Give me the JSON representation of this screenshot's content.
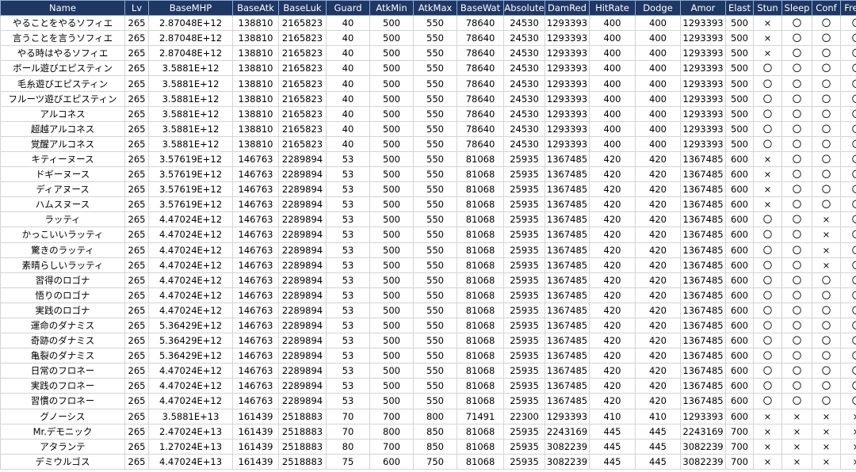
{
  "columns": [
    "Name",
    "Lv",
    "BaseMHP",
    "BaseAtk",
    "BaseLuk",
    "Guard",
    "AtkMin",
    "AtkMax",
    "BaseWat",
    "Absolute",
    "DamRed",
    "HitRate",
    "Dodge",
    "Amor",
    "Elast",
    "Stun",
    "Sleep",
    "Conf",
    "Freez"
  ],
  "rows": [
    [
      "やることをやるソフィエ",
      "265",
      "2.87048E+12",
      "138810",
      "2165823",
      "40",
      "500",
      "550",
      "78640",
      "24530",
      "1293393",
      "400",
      "400",
      "1293393",
      "500",
      "×",
      "〇",
      "〇",
      "〇"
    ],
    [
      "言うことを言うソフィエ",
      "265",
      "2.87048E+12",
      "138810",
      "2165823",
      "40",
      "500",
      "550",
      "78640",
      "24530",
      "1293393",
      "400",
      "400",
      "1293393",
      "500",
      "×",
      "〇",
      "〇",
      "〇"
    ],
    [
      "やる時はやるソフィエ",
      "265",
      "2.87048E+12",
      "138810",
      "2165823",
      "40",
      "500",
      "550",
      "78640",
      "24530",
      "1293393",
      "400",
      "400",
      "1293393",
      "500",
      "×",
      "〇",
      "〇",
      "〇"
    ],
    [
      "ボール遊びエピスティン",
      "265",
      "3.5881E+12",
      "138810",
      "2165823",
      "40",
      "500",
      "550",
      "78640",
      "24530",
      "1293393",
      "400",
      "400",
      "1293393",
      "500",
      "〇",
      "〇",
      "〇",
      "〇"
    ],
    [
      "毛糸遊びエピスティン",
      "265",
      "3.5881E+12",
      "138810",
      "2165823",
      "40",
      "500",
      "550",
      "78640",
      "24530",
      "1293393",
      "400",
      "400",
      "1293393",
      "500",
      "〇",
      "〇",
      "〇",
      "〇"
    ],
    [
      "フルーツ遊びエピスティン",
      "265",
      "3.5881E+12",
      "138810",
      "2165823",
      "40",
      "500",
      "550",
      "78640",
      "24530",
      "1293393",
      "400",
      "400",
      "1293393",
      "500",
      "〇",
      "〇",
      "〇",
      "〇"
    ],
    [
      "アルコネス",
      "265",
      "3.5881E+12",
      "138810",
      "2165823",
      "40",
      "500",
      "550",
      "78640",
      "24530",
      "1293393",
      "400",
      "400",
      "1293393",
      "500",
      "〇",
      "〇",
      "〇",
      "〇"
    ],
    [
      "超越アルコネス",
      "265",
      "3.5881E+12",
      "138810",
      "2165823",
      "40",
      "500",
      "550",
      "78640",
      "24530",
      "1293393",
      "400",
      "400",
      "1293393",
      "500",
      "〇",
      "〇",
      "〇",
      "〇"
    ],
    [
      "覚醒アルコネス",
      "265",
      "3.5881E+12",
      "138810",
      "2165823",
      "40",
      "500",
      "550",
      "78640",
      "24530",
      "1293393",
      "400",
      "400",
      "1293393",
      "500",
      "〇",
      "〇",
      "〇",
      "〇"
    ],
    [
      "キティーヌース",
      "265",
      "3.57619E+12",
      "146763",
      "2289894",
      "53",
      "500",
      "550",
      "81068",
      "25935",
      "1367485",
      "420",
      "420",
      "1367485",
      "600",
      "×",
      "〇",
      "〇",
      "〇"
    ],
    [
      "ドギーヌース",
      "265",
      "3.57619E+12",
      "146763",
      "2289894",
      "53",
      "500",
      "550",
      "81068",
      "25935",
      "1367485",
      "420",
      "420",
      "1367485",
      "600",
      "×",
      "〇",
      "〇",
      "〇"
    ],
    [
      "ディアヌース",
      "265",
      "3.57619E+12",
      "146763",
      "2289894",
      "53",
      "500",
      "550",
      "81068",
      "25935",
      "1367485",
      "420",
      "420",
      "1367485",
      "600",
      "×",
      "〇",
      "〇",
      "〇"
    ],
    [
      "ハムスヌース",
      "265",
      "3.57619E+12",
      "146763",
      "2289894",
      "53",
      "500",
      "550",
      "81068",
      "25935",
      "1367485",
      "420",
      "420",
      "1367485",
      "600",
      "×",
      "〇",
      "〇",
      "〇"
    ],
    [
      "ラッティ",
      "265",
      "4.47024E+12",
      "146763",
      "2289894",
      "53",
      "500",
      "550",
      "81068",
      "25935",
      "1367485",
      "420",
      "420",
      "1367485",
      "600",
      "〇",
      "〇",
      "×",
      "〇"
    ],
    [
      "かっこいいラッティ",
      "265",
      "4.47024E+12",
      "146763",
      "2289894",
      "53",
      "500",
      "550",
      "81068",
      "25935",
      "1367485",
      "420",
      "420",
      "1367485",
      "600",
      "〇",
      "〇",
      "×",
      "〇"
    ],
    [
      "驚きのラッティ",
      "265",
      "4.47024E+12",
      "146763",
      "2289894",
      "53",
      "500",
      "550",
      "81068",
      "25935",
      "1367485",
      "420",
      "420",
      "1367485",
      "600",
      "〇",
      "〇",
      "×",
      "〇"
    ],
    [
      "素晴らしいラッティ",
      "265",
      "4.47024E+12",
      "146763",
      "2289894",
      "53",
      "500",
      "550",
      "81068",
      "25935",
      "1367485",
      "420",
      "420",
      "1367485",
      "600",
      "〇",
      "〇",
      "×",
      "〇"
    ],
    [
      "習得のロゴナ",
      "265",
      "4.47024E+12",
      "146763",
      "2289894",
      "53",
      "500",
      "550",
      "81068",
      "25935",
      "1367485",
      "420",
      "420",
      "1367485",
      "600",
      "〇",
      "〇",
      "〇",
      "〇"
    ],
    [
      "悟りのロゴナ",
      "265",
      "4.47024E+12",
      "146763",
      "2289894",
      "53",
      "500",
      "550",
      "81068",
      "25935",
      "1367485",
      "420",
      "420",
      "1367485",
      "600",
      "〇",
      "〇",
      "〇",
      "〇"
    ],
    [
      "実践のロゴナ",
      "265",
      "4.47024E+12",
      "146763",
      "2289894",
      "53",
      "500",
      "550",
      "81068",
      "25935",
      "1367485",
      "420",
      "420",
      "1367485",
      "600",
      "〇",
      "〇",
      "〇",
      "〇"
    ],
    [
      "運命のダナミス",
      "265",
      "5.36429E+12",
      "146763",
      "2289894",
      "53",
      "500",
      "550",
      "81068",
      "25935",
      "1367485",
      "420",
      "420",
      "1367485",
      "600",
      "〇",
      "〇",
      "〇",
      "〇"
    ],
    [
      "奇跡のダナミス",
      "265",
      "5.36429E+12",
      "146763",
      "2289894",
      "53",
      "500",
      "550",
      "81068",
      "25935",
      "1367485",
      "420",
      "420",
      "1367485",
      "600",
      "〇",
      "〇",
      "〇",
      "〇"
    ],
    [
      "亀裂のダナミス",
      "265",
      "5.36429E+12",
      "146763",
      "2289894",
      "53",
      "500",
      "550",
      "81068",
      "25935",
      "1367485",
      "420",
      "420",
      "1367485",
      "600",
      "〇",
      "〇",
      "〇",
      "〇"
    ],
    [
      "日常のフロネー",
      "265",
      "4.47024E+12",
      "146763",
      "2289894",
      "53",
      "500",
      "550",
      "81068",
      "25935",
      "1367485",
      "420",
      "420",
      "1367485",
      "600",
      "〇",
      "〇",
      "〇",
      "〇"
    ],
    [
      "実践のフロネー",
      "265",
      "4.47024E+12",
      "146763",
      "2289894",
      "53",
      "500",
      "550",
      "81068",
      "25935",
      "1367485",
      "420",
      "420",
      "1367485",
      "600",
      "〇",
      "〇",
      "〇",
      "〇"
    ],
    [
      "習慣のフロネー",
      "265",
      "4.47024E+12",
      "146763",
      "2289894",
      "53",
      "500",
      "550",
      "81068",
      "25935",
      "1367485",
      "420",
      "420",
      "1367485",
      "600",
      "〇",
      "〇",
      "〇",
      "〇"
    ],
    [
      "グノーシス",
      "265",
      "3.5881E+13",
      "161439",
      "2518883",
      "70",
      "700",
      "800",
      "71491",
      "22300",
      "1293393",
      "410",
      "410",
      "1293393",
      "600",
      "×",
      "×",
      "×",
      "×"
    ],
    [
      "Mr.デモニック",
      "265",
      "2.47024E+13",
      "161439",
      "2518883",
      "70",
      "800",
      "850",
      "81068",
      "25935",
      "2243169",
      "445",
      "445",
      "2243169",
      "700",
      "×",
      "×",
      "×",
      "×"
    ],
    [
      "アタランテ",
      "265",
      "1.27024E+13",
      "161439",
      "2518883",
      "80",
      "700",
      "850",
      "81068",
      "25935",
      "3082239",
      "445",
      "445",
      "3082239",
      "700",
      "×",
      "×",
      "×",
      "×"
    ],
    [
      "デミウルゴス",
      "265",
      "4.47024E+13",
      "161439",
      "2518883",
      "75",
      "600",
      "750",
      "81068",
      "25935",
      "3082239",
      "445",
      "445",
      "3082239",
      "700",
      "×",
      "×",
      "×",
      "×"
    ]
  ]
}
